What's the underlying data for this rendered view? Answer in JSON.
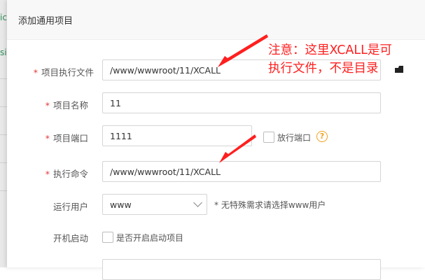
{
  "background": {
    "fragment_top": "ic",
    "fragment_mid": "si"
  },
  "dialog": {
    "title": "添加通用项目",
    "fields": {
      "exec_file": {
        "label": "项目执行文件",
        "value": "/www/wwwroot/11/XCALL",
        "required": true
      },
      "name": {
        "label": "项目名称",
        "value": "11",
        "required": true
      },
      "port": {
        "label": "项目端口",
        "value": "1111",
        "required": true
      },
      "release_port": {
        "label": "放行端口",
        "checked": false
      },
      "command": {
        "label": "执行命令",
        "value": "/www/wwwroot/11/XCALL",
        "required": true
      },
      "run_user": {
        "label": "运行用户",
        "value": "www",
        "hint": "* 无特殊需求请选择www用户"
      },
      "autostart": {
        "label": "开机启动",
        "checkbox_label": "是否开启启动项目",
        "checked": false
      }
    },
    "required_mark": "*",
    "help_icon": "?"
  },
  "annotation": {
    "line1": "注意：这里XCALL是可",
    "line2": "执行文件，不是目录",
    "color": "#ff1f1f"
  }
}
